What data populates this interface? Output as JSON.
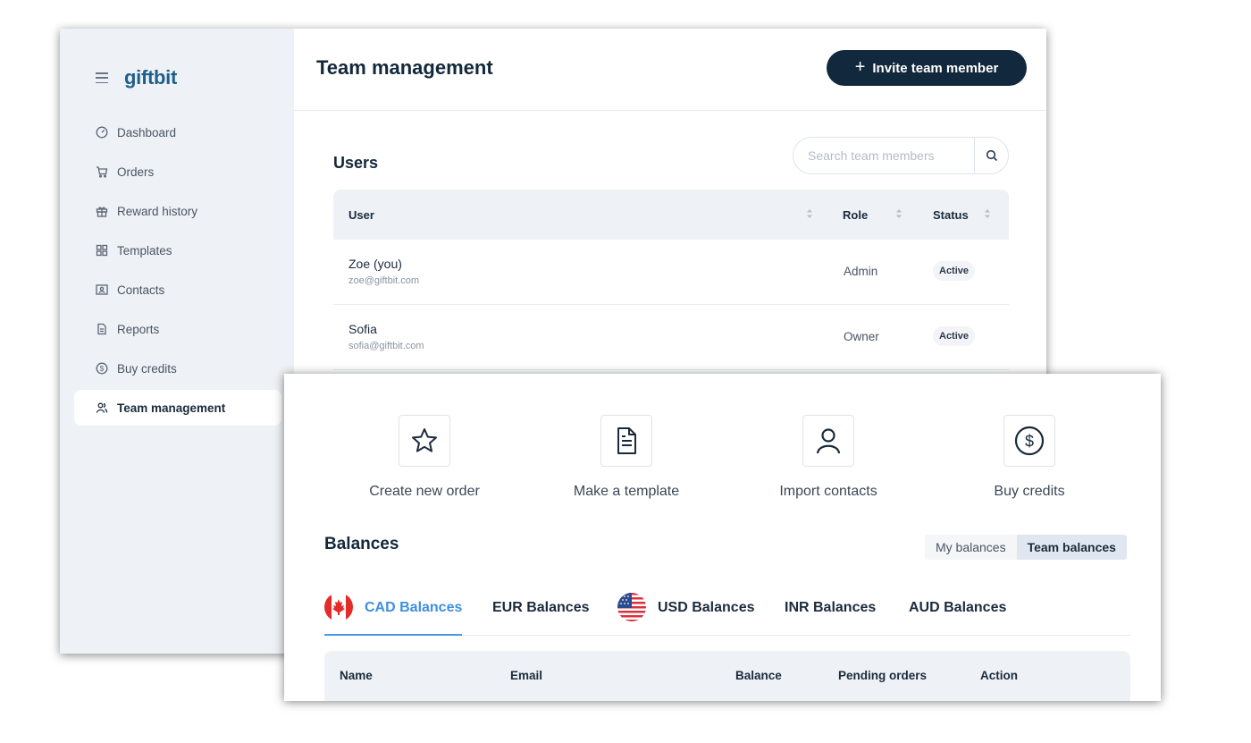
{
  "app": {
    "logo": "giftbit"
  },
  "sidebar": {
    "items": [
      {
        "label": "Dashboard",
        "icon": "dashboard-gauge-icon",
        "active": false
      },
      {
        "label": "Orders",
        "icon": "cart-icon",
        "active": false
      },
      {
        "label": "Reward history",
        "icon": "gift-icon",
        "active": false
      },
      {
        "label": "Templates",
        "icon": "grid-icon",
        "active": false
      },
      {
        "label": "Contacts",
        "icon": "contact-card-icon",
        "active": false
      },
      {
        "label": "Reports",
        "icon": "document-icon",
        "active": false
      },
      {
        "label": "Buy credits",
        "icon": "dollar-coin-icon",
        "active": false
      },
      {
        "label": "Team management",
        "icon": "team-icon",
        "active": true
      }
    ]
  },
  "header": {
    "title": "Team management",
    "invite_label": "Invite team member"
  },
  "users": {
    "title": "Users",
    "search_placeholder": "Search team members",
    "columns": {
      "user": "User",
      "role": "Role",
      "status": "Status"
    },
    "rows": [
      {
        "name": "Zoe (you)",
        "email": "zoe@giftbit.com",
        "role": "Admin",
        "status": "Active"
      },
      {
        "name": "Sofia",
        "email": "sofia@giftbit.com",
        "role": "Owner",
        "status": "Active"
      }
    ]
  },
  "quick_actions": [
    {
      "label": "Create new order",
      "icon": "star-icon"
    },
    {
      "label": "Make a template",
      "icon": "document-icon"
    },
    {
      "label": "Import contacts",
      "icon": "person-icon"
    },
    {
      "label": "Buy credits",
      "icon": "dollar-circle-icon"
    }
  ],
  "balances": {
    "title": "Balances",
    "toggle": {
      "mine": "My balances",
      "team": "Team balances",
      "selected": "team"
    },
    "tabs": [
      {
        "label": "CAD Balances",
        "flag": "canada",
        "active": true
      },
      {
        "label": "EUR Balances",
        "flag": null,
        "active": false
      },
      {
        "label": "USD Balances",
        "flag": "usa",
        "active": false
      },
      {
        "label": "INR Balances",
        "flag": null,
        "active": false
      },
      {
        "label": "AUD Balances",
        "flag": null,
        "active": false
      }
    ],
    "columns": {
      "name": "Name",
      "email": "Email",
      "balance": "Balance",
      "pending": "Pending orders",
      "action": "Action"
    }
  },
  "colors": {
    "primary_dark": "#12283d",
    "accent_blue": "#3f8fe0",
    "sidebar_bg": "#eef1f5",
    "canada_red": "#e52a2a"
  }
}
